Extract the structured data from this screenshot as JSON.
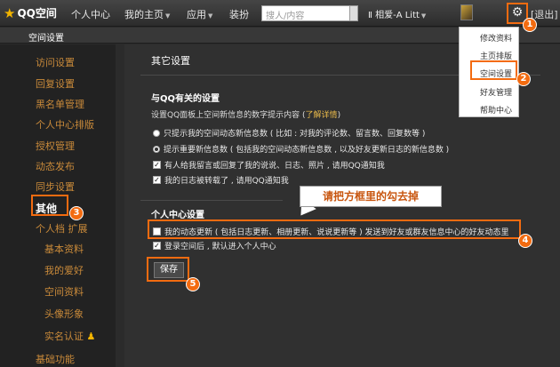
{
  "topbar": {
    "logo_text": "QQ空间",
    "nav": [
      "个人中心",
      "我的主页",
      "应用",
      "装扮"
    ],
    "search_placeholder": "搜人/内容",
    "music": "Ⅱ 相爱-A Litt",
    "logout": "[退出]"
  },
  "header": {
    "title": "空间设置"
  },
  "sidebar": {
    "items": [
      "访问设置",
      "回复设置",
      "黑名单管理",
      "个人中心排版",
      "授权管理",
      "动态发布",
      "同步设置",
      "其他",
      "个人档 扩展",
      "基础功能"
    ],
    "sub_items": [
      "基本资料",
      "我的爱好",
      "空间资料",
      "头像形象",
      "实名认证"
    ]
  },
  "main": {
    "title": "其它设置",
    "section1_title": "与QQ有关的设置",
    "section1_desc": "设置QQ面板上空间新信息的数字提示内容 (",
    "section1_link": "了解详情",
    "section1_desc_end": ")",
    "radio1": "只提示我的空间动态新信息数 ( 比如 : 对我的评论数、留言数、回复数等 )",
    "radio2": "提示重要新信息数 ( 包括我的空间动态新信息数 , 以及好友更新日志的新信息数 )",
    "check1": "有人给我留言或回复了我的说说、日志、照片 , 请用QQ通知我",
    "check2": "我的日志被转载了 , 请用QQ通知我",
    "section2_title": "个人中心设置",
    "check3": "我的动态更新 ( 包括日志更新、相册更新、说说更新等 ) 发送到好友或群友信息中心的好友动态里",
    "check4": "登录空间后 , 默认进入个人中心",
    "save_label": "保存"
  },
  "dropdown": {
    "items": [
      "修改资料",
      "主页排版",
      "空间设置",
      "好友管理",
      "帮助中心"
    ]
  },
  "callout": "请把方框里的勾去掉",
  "badges": [
    "1",
    "2",
    "3",
    "4",
    "5"
  ],
  "colors": {
    "accent": "#f36b10",
    "sidebar_text": "#c98a3a"
  }
}
